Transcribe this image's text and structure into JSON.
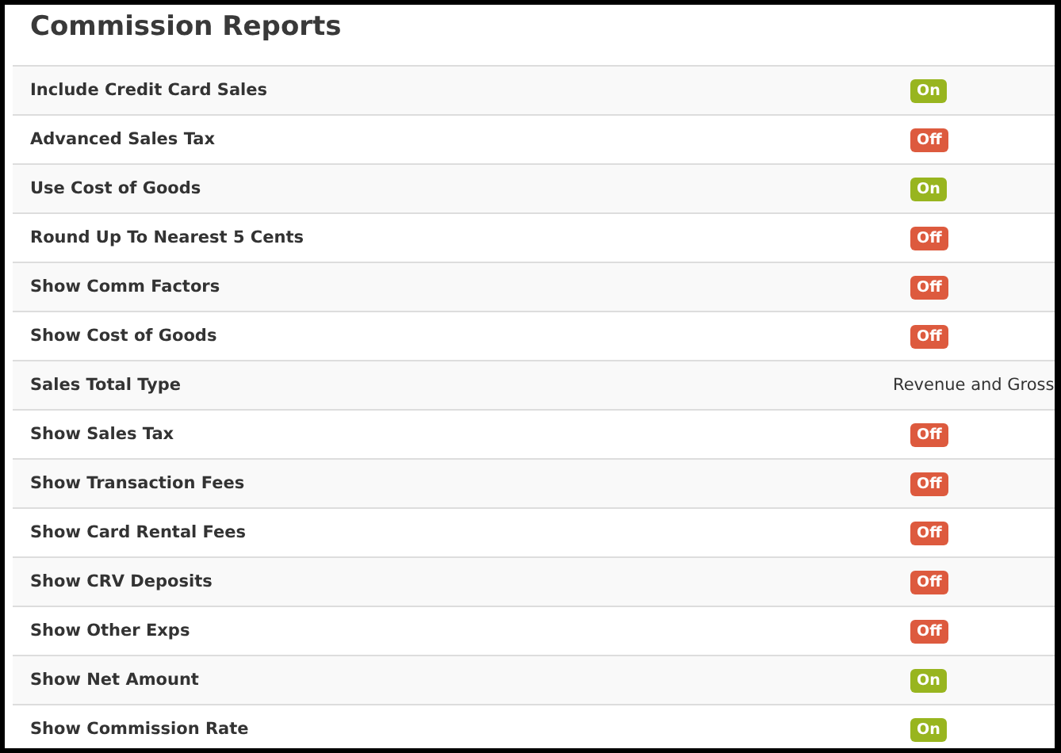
{
  "title": "Commission Reports",
  "rows": [
    {
      "label": "Include Credit Card Sales",
      "kind": "toggle",
      "on": true,
      "value": "On"
    },
    {
      "label": "Advanced Sales Tax",
      "kind": "toggle",
      "on": false,
      "value": "Off"
    },
    {
      "label": "Use Cost of Goods",
      "kind": "toggle",
      "on": true,
      "value": "On"
    },
    {
      "label": "Round Up To Nearest 5 Cents",
      "kind": "toggle",
      "on": false,
      "value": "Off"
    },
    {
      "label": "Show Comm Factors",
      "kind": "toggle",
      "on": false,
      "value": "Off"
    },
    {
      "label": "Show Cost of Goods",
      "kind": "toggle",
      "on": false,
      "value": "Off"
    },
    {
      "label": "Sales Total Type",
      "kind": "text",
      "value": "Revenue and Gross"
    },
    {
      "label": "Show Sales Tax",
      "kind": "toggle",
      "on": false,
      "value": "Off"
    },
    {
      "label": "Show Transaction Fees",
      "kind": "toggle",
      "on": false,
      "value": "Off"
    },
    {
      "label": "Show Card Rental Fees",
      "kind": "toggle",
      "on": false,
      "value": "Off"
    },
    {
      "label": "Show CRV Deposits",
      "kind": "toggle",
      "on": false,
      "value": "Off"
    },
    {
      "label": "Show Other Exps",
      "kind": "toggle",
      "on": false,
      "value": "Off"
    },
    {
      "label": "Show Net Amount",
      "kind": "toggle",
      "on": true,
      "value": "On"
    },
    {
      "label": "Show Commission Rate",
      "kind": "toggle",
      "on": true,
      "value": "On"
    }
  ]
}
